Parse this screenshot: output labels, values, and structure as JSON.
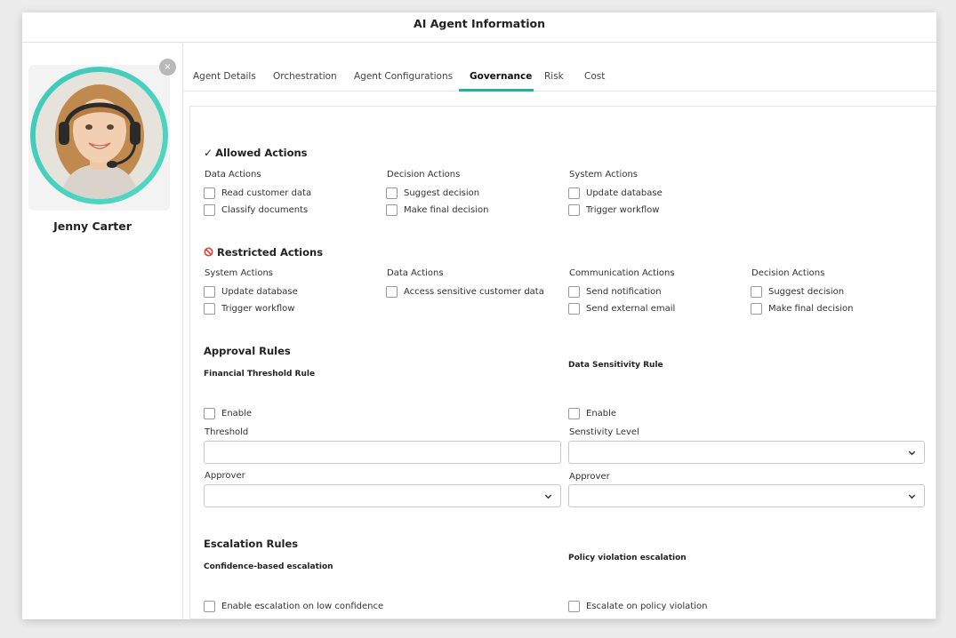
{
  "window": {
    "title": "AI Agent Information"
  },
  "profile": {
    "name": "Jenny Carter",
    "close_glyph": "×"
  },
  "tabs": [
    "Agent Details",
    "Orchestration",
    "Agent Configurations",
    "Governance",
    "Risk",
    "Cost"
  ],
  "active_tab": "Governance",
  "allowed": {
    "icon": "✓",
    "title": "Allowed Actions",
    "groups": [
      {
        "title": "Data Actions",
        "items": [
          "Read customer data",
          "Classify documents"
        ]
      },
      {
        "title": "Decision Actions",
        "items": [
          "Suggest decision",
          "Make final decision"
        ]
      },
      {
        "title": "System Actions",
        "items": [
          "Update database",
          "Trigger workflow"
        ]
      }
    ]
  },
  "restricted": {
    "icon": "ban-icon",
    "title": "Restricted Actions",
    "groups": [
      {
        "title": "System Actions",
        "items": [
          "Update database",
          "Trigger workflow"
        ]
      },
      {
        "title": "Data Actions",
        "items": [
          "Access sensitive customer data"
        ]
      },
      {
        "title": "Communication Actions",
        "items": [
          "Send notification",
          "Send external email"
        ]
      },
      {
        "title": "Decision Actions",
        "items": [
          "Suggest decision",
          "Make final decision"
        ]
      }
    ]
  },
  "approval": {
    "title": "Approval Rules",
    "financial": {
      "title": "Financial Threshold Rule",
      "enable_label": "Enable",
      "threshold_label": "Threshold",
      "threshold_value": "",
      "approver_label": "Approver",
      "approver_value": ""
    },
    "sensitivity": {
      "title": "Data Sensitivity Rule",
      "enable_label": "Enable",
      "level_label": "Senstivity Level",
      "level_value": "",
      "approver_label": "Approver",
      "approver_value": ""
    }
  },
  "escalation": {
    "title": "Escalation Rules",
    "confidence": {
      "title": "Confidence-based escalation",
      "option": "Enable escalation on low confidence"
    },
    "policy": {
      "title": "Policy violation escalation",
      "option": "Escalate on policy violation"
    }
  },
  "colors": {
    "accent": "#23b39a",
    "avatar_ring": "#3ec8b8",
    "restricted_icon": "#e0443a"
  }
}
